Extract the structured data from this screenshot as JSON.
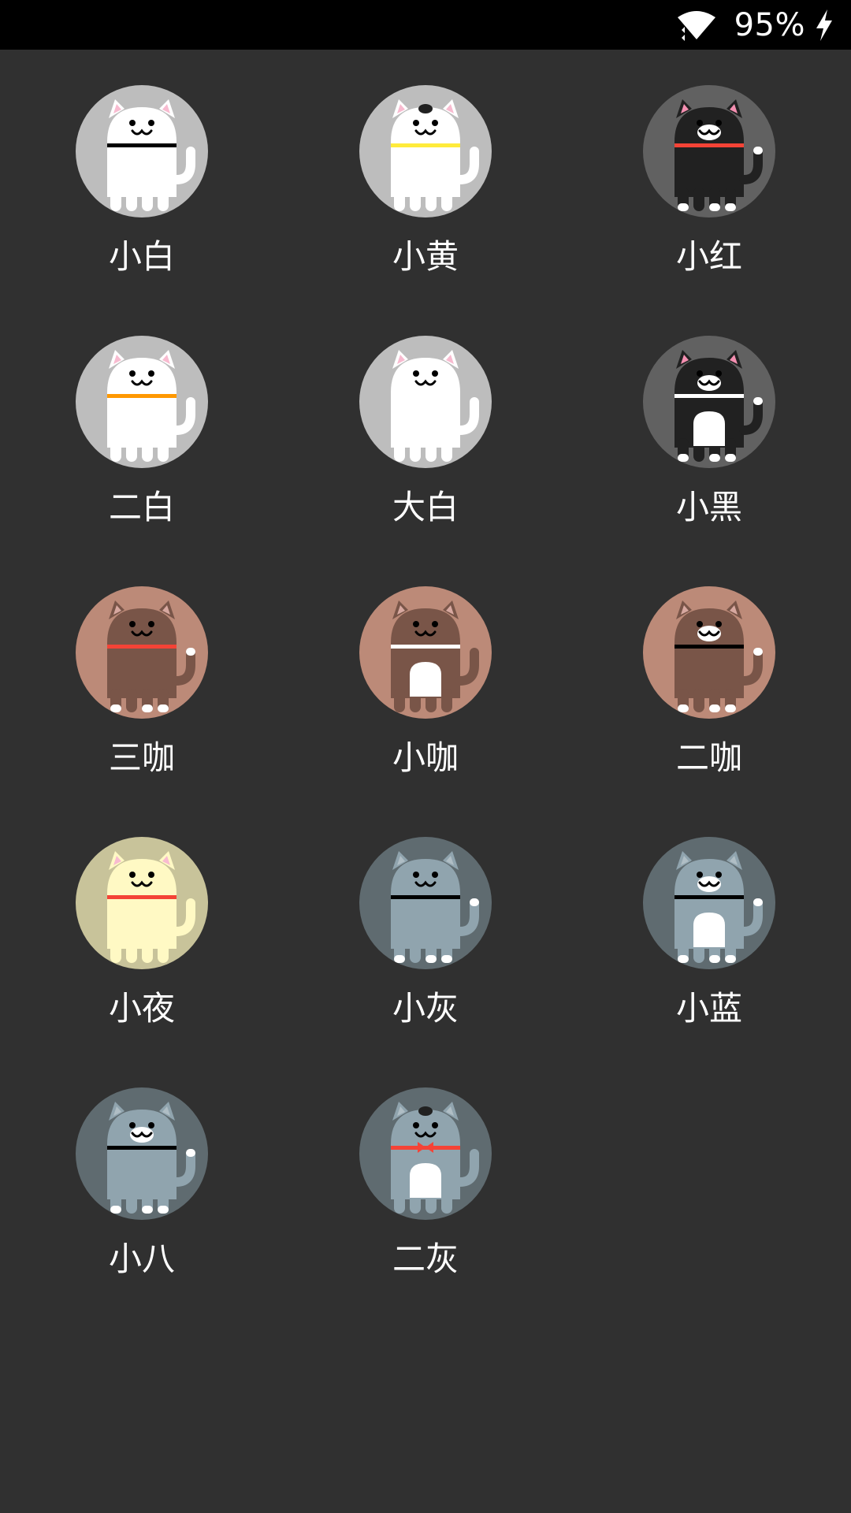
{
  "status_bar": {
    "battery": "95%",
    "icons": [
      "wifi-icon",
      "charging-icon"
    ]
  },
  "cats": [
    {
      "name": "小白",
      "bg": "#bdbdbd",
      "body": "#ffffff",
      "collar": "#000000",
      "ear": "#f8bbd0",
      "face": "#000000",
      "chin": false,
      "belly": false,
      "spot": false,
      "toes": false,
      "bowtie": false
    },
    {
      "name": "小黄",
      "bg": "#bdbdbd",
      "body": "#ffffff",
      "collar": "#ffeb3b",
      "ear": "#f8bbd0",
      "face": "#000000",
      "chin": false,
      "belly": false,
      "spot": true,
      "toes": false,
      "bowtie": false
    },
    {
      "name": "小红",
      "bg": "#616161",
      "body": "#212121",
      "collar": "#f44336",
      "ear": "#f48fb1",
      "face": "#000000",
      "chin": true,
      "belly": false,
      "spot": false,
      "toes": true,
      "bowtie": false
    },
    {
      "name": "二白",
      "bg": "#bdbdbd",
      "body": "#ffffff",
      "collar": "#ff9800",
      "ear": "#f8bbd0",
      "face": "#000000",
      "chin": false,
      "belly": false,
      "spot": false,
      "toes": false,
      "bowtie": false
    },
    {
      "name": "大白",
      "bg": "#bdbdbd",
      "body": "#ffffff",
      "collar": "",
      "ear": "#f8bbd0",
      "face": "#000000",
      "chin": false,
      "belly": false,
      "spot": false,
      "toes": false,
      "bowtie": false
    },
    {
      "name": "小黑",
      "bg": "#616161",
      "body": "#212121",
      "collar": "#ffffff",
      "ear": "#f48fb1",
      "face": "#000000",
      "chin": true,
      "belly": true,
      "spot": false,
      "toes": true,
      "bowtie": false
    },
    {
      "name": "三咖",
      "bg": "#bc8a78",
      "body": "#795548",
      "collar": "#f44336",
      "ear": "#d7a8a0",
      "face": "#000000",
      "chin": false,
      "belly": false,
      "spot": false,
      "toes": true,
      "bowtie": false
    },
    {
      "name": "小咖",
      "bg": "#bc8a78",
      "body": "#795548",
      "collar": "#ffffff",
      "ear": "#d7a8a0",
      "face": "#000000",
      "chin": false,
      "belly": true,
      "spot": false,
      "toes": false,
      "bowtie": false
    },
    {
      "name": "二咖",
      "bg": "#bc8a78",
      "body": "#795548",
      "collar": "#000000",
      "ear": "#d7a8a0",
      "face": "#000000",
      "chin": true,
      "belly": false,
      "spot": false,
      "toes": true,
      "bowtie": false
    },
    {
      "name": "小夜",
      "bg": "#c8c39a",
      "body": "#fff9c4",
      "collar": "#f44336",
      "ear": "#f8bbd0",
      "face": "#000000",
      "chin": false,
      "belly": false,
      "spot": false,
      "toes": false,
      "bowtie": false
    },
    {
      "name": "小灰",
      "bg": "#5f6b70",
      "body": "#90a4ae",
      "collar": "#000000",
      "ear": "#b0bec5",
      "face": "#000000",
      "chin": false,
      "belly": false,
      "spot": false,
      "toes": true,
      "bowtie": false
    },
    {
      "name": "小蓝",
      "bg": "#5f6b70",
      "body": "#90a4ae",
      "collar": "#000000",
      "ear": "#b0bec5",
      "face": "#000000",
      "chin": true,
      "belly": true,
      "spot": false,
      "toes": true,
      "bowtie": false
    },
    {
      "name": "小八",
      "bg": "#5f6b70",
      "body": "#90a4ae",
      "collar": "#000000",
      "ear": "#b0bec5",
      "face": "#000000",
      "chin": true,
      "belly": false,
      "spot": false,
      "toes": true,
      "bowtie": false
    },
    {
      "name": "二灰",
      "bg": "#5f6b70",
      "body": "#90a4ae",
      "collar": "#f44336",
      "ear": "#b0bec5",
      "face": "#000000",
      "chin": false,
      "belly": true,
      "spot": true,
      "toes": false,
      "bowtie": true
    }
  ]
}
